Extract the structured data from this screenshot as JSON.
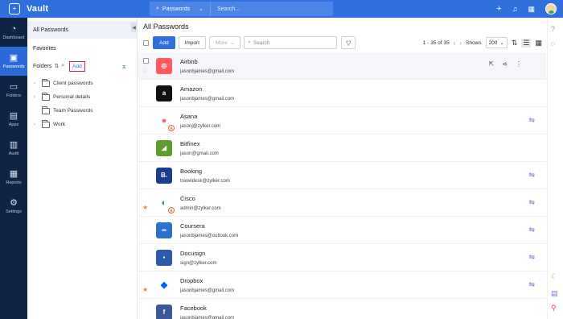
{
  "app": {
    "title": "Vault"
  },
  "search": {
    "scope": "Passwords",
    "placeholder": "Search..."
  },
  "topbar": {
    "icons": [
      "plus-icon",
      "bell-icon",
      "apps-grid-icon",
      "avatar"
    ]
  },
  "rail": {
    "items": [
      {
        "label": "Dashboard",
        "icon": "dashboard-icon",
        "glyph": "◔"
      },
      {
        "label": "Passwords",
        "icon": "passwords-icon",
        "glyph": "▣",
        "active": true
      },
      {
        "label": "Folders",
        "icon": "folders-icon",
        "glyph": "▭"
      },
      {
        "label": "Apps",
        "icon": "apps-icon",
        "glyph": "▤"
      },
      {
        "label": "Audit",
        "icon": "audit-icon",
        "glyph": "▥"
      },
      {
        "label": "Reports",
        "icon": "reports-icon",
        "glyph": "▦"
      },
      {
        "label": "Settings",
        "icon": "settings-icon",
        "glyph": "⚙"
      }
    ]
  },
  "pane": {
    "all_passwords": "All Passwords",
    "favorites": "Favorites",
    "folders_label": "Folders",
    "add_label": "Add",
    "folders": [
      {
        "name": "Client passwords",
        "expandable": true
      },
      {
        "name": "Personal details",
        "expandable": true
      },
      {
        "name": "Team Passwords",
        "expandable": false
      },
      {
        "name": "Work",
        "expandable": true
      }
    ]
  },
  "main": {
    "title": "All Passwords",
    "toolbar": {
      "add": "Add",
      "import": "Import",
      "more": "More",
      "search_placeholder": "Search",
      "range": "1 - 35 of 35",
      "shows_label": "Shows",
      "page_size": "200"
    }
  },
  "passwords": [
    {
      "name": "Airbnb",
      "email": "jasonbjames@gmail.com",
      "logo_text": "◎",
      "logo_bg": "#ff5a5f",
      "fav": false,
      "locked": false,
      "shared": false,
      "hover": true
    },
    {
      "name": "Amazon",
      "email": "jasonbjames@gmail.com",
      "logo_text": "a",
      "logo_bg": "#111111",
      "fav": false,
      "locked": false,
      "shared": false
    },
    {
      "name": "Asana",
      "email": "jasonj@zylker.com",
      "logo_text": "●",
      "logo_bg": "#ffffff",
      "logo_fg": "#f06a6a",
      "fav": false,
      "locked": true,
      "shared": true
    },
    {
      "name": "Bitfinex",
      "email": "jason@gmail.com",
      "logo_text": "◢",
      "logo_bg": "#5e9e2f",
      "fav": false,
      "locked": false,
      "shared": false
    },
    {
      "name": "Booking",
      "email": "traveldesk@zylker.com",
      "logo_text": "B.",
      "logo_bg": "#1a3e8c",
      "fav": false,
      "locked": false,
      "shared": true
    },
    {
      "name": "Cisco",
      "email": "admin@zylker.com",
      "logo_text": "◐",
      "logo_bg": "#ffffff",
      "logo_fg": "#1d8a6f",
      "fav": true,
      "locked": true,
      "shared": true
    },
    {
      "name": "Coursera",
      "email": "jasonbjames@outlook.com",
      "logo_text": "∞",
      "logo_bg": "#2a73cc",
      "fav": false,
      "locked": false,
      "shared": true
    },
    {
      "name": "Docusign",
      "email": "sign@zylker.com",
      "logo_text": "▪",
      "logo_bg": "#2b5aa8",
      "fav": false,
      "locked": false,
      "shared": true
    },
    {
      "name": "Dropbox",
      "email": "jasonbjames@gmail.com",
      "logo_text": "◆",
      "logo_bg": "#ffffff",
      "logo_fg": "#0061fe",
      "fav": true,
      "locked": false,
      "shared": true
    },
    {
      "name": "Facebook",
      "email": "jasonbjames@gmail.com",
      "logo_text": "f",
      "logo_bg": "#3b5998",
      "fav": false,
      "locked": false,
      "shared": false
    }
  ],
  "right_rail": {
    "icons": [
      "help-icon",
      "refresh-icon",
      "moon-icon",
      "chat-icon",
      "location-icon"
    ]
  }
}
